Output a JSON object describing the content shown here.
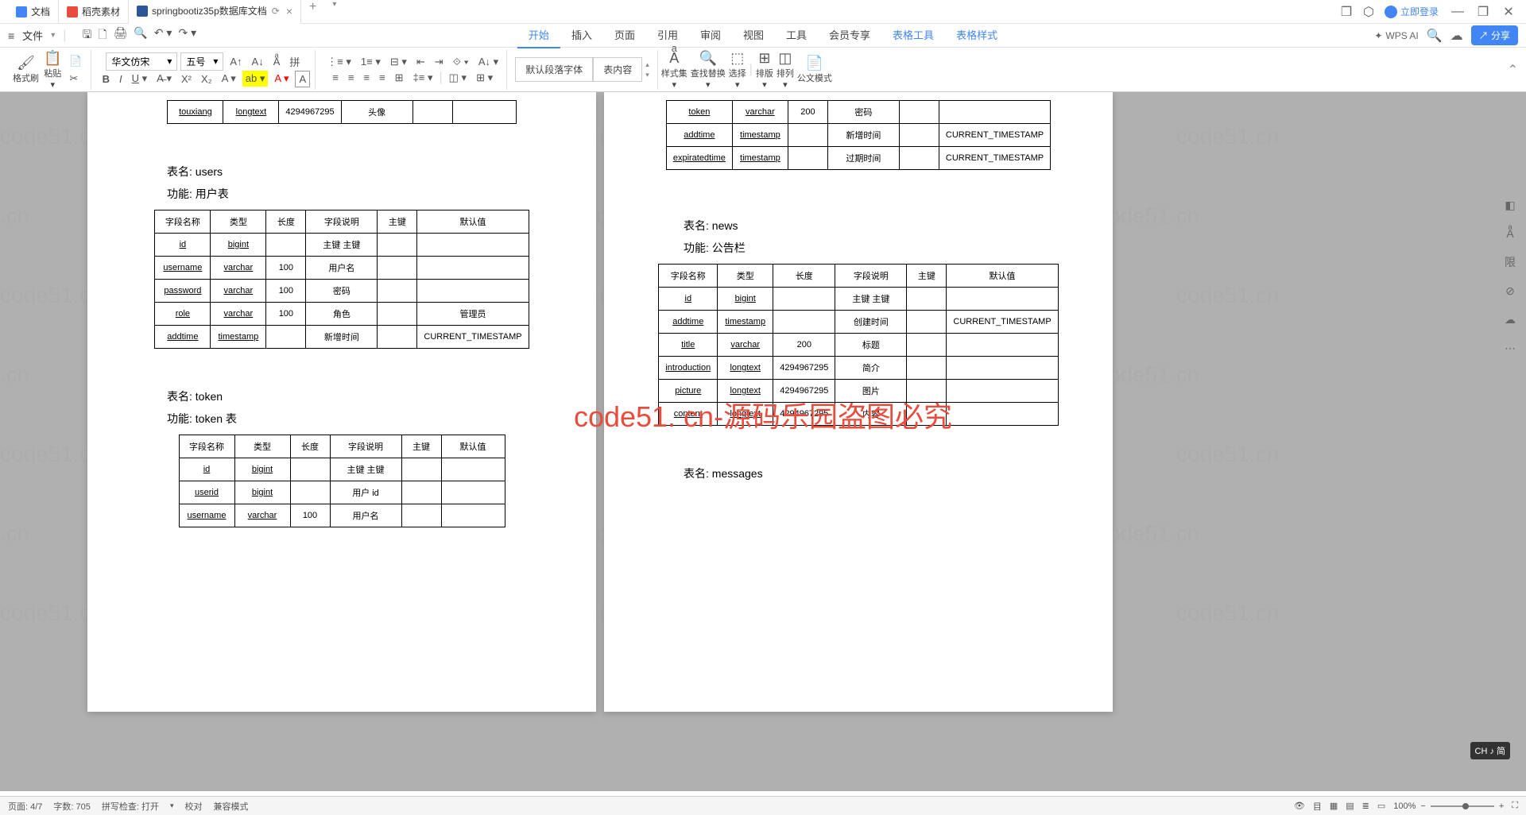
{
  "tabs": [
    {
      "label": "文档",
      "icon": "doc"
    },
    {
      "label": "稻壳素材",
      "icon": "docker"
    },
    {
      "label": "springbootiz35p数据库文档",
      "icon": "word",
      "active": true
    }
  ],
  "titlebar": {
    "login": "立即登录"
  },
  "menu": {
    "file": "文件"
  },
  "ribbon_tabs": [
    "开始",
    "插入",
    "页面",
    "引用",
    "审阅",
    "视图",
    "工具",
    "会员专享",
    "表格工具",
    "表格样式"
  ],
  "ribbon_active": "开始",
  "wps_ai": "WPS AI",
  "share": "分享",
  "ribbon": {
    "format_brush": "格式刷",
    "paste": "粘贴",
    "font": "华文仿宋",
    "size": "五号",
    "style1": "默认段落字体",
    "style2": "表内容",
    "styles_set": "样式集",
    "find_replace": "查找替换",
    "select": "选择",
    "layout": "排版",
    "arrange": "排列",
    "official": "公文模式"
  },
  "watermarks": [
    "code51.cn"
  ],
  "overlay": "code51. cn-源码乐园盗图必究",
  "left_page": {
    "table1": [
      [
        "touxiang",
        "longtext",
        "4294967295",
        "头像",
        "",
        ""
      ]
    ],
    "users_name": "表名: users",
    "users_func": "功能: 用户表",
    "users_headers": [
      "字段名称",
      "类型",
      "长度",
      "字段说明",
      "主键",
      "默认值"
    ],
    "users_rows": [
      [
        "id",
        "bigint",
        "",
        "主键\n主键",
        "",
        ""
      ],
      [
        "username",
        "varchar",
        "100",
        "用户名",
        "",
        ""
      ],
      [
        "password",
        "varchar",
        "100",
        "密码",
        "",
        ""
      ],
      [
        "role",
        "varchar",
        "100",
        "角色",
        "",
        "管理员"
      ],
      [
        "addtime",
        "timestamp",
        "",
        "新增时间",
        "",
        "CURRENT_TIMESTAMP"
      ]
    ],
    "token_name": "表名: token",
    "token_func": "功能: token 表",
    "token_headers": [
      "字段名称",
      "类型",
      "长度",
      "字段说明",
      "主键",
      "默认值"
    ],
    "token_rows": [
      [
        "id",
        "bigint",
        "",
        "主键\n主键",
        "",
        ""
      ],
      [
        "userid",
        "bigint",
        "",
        "用户 id",
        "",
        ""
      ],
      [
        "username",
        "varchar",
        "100",
        "用户名",
        "",
        ""
      ]
    ]
  },
  "right_page": {
    "table1": [
      [
        "token",
        "varchar",
        "200",
        "密码",
        "",
        ""
      ],
      [
        "addtime",
        "timestamp",
        "",
        "新增时间",
        "",
        "CURRENT_TIMESTAMP"
      ],
      [
        "expiratedtime",
        "timestamp",
        "",
        "过期时间",
        "",
        "CURRENT_TIMESTAMP"
      ]
    ],
    "news_name": "表名: news",
    "news_func": "功能: 公告栏",
    "news_headers": [
      "字段名称",
      "类型",
      "长度",
      "字段说明",
      "主键",
      "默认值"
    ],
    "news_rows": [
      [
        "id",
        "bigint",
        "",
        "主键\n主键",
        "",
        ""
      ],
      [
        "addtime",
        "timestamp",
        "",
        "创建时间",
        "",
        "CURRENT_TIMESTAMP"
      ],
      [
        "title",
        "varchar",
        "200",
        "标题",
        "",
        ""
      ],
      [
        "introduction",
        "longtext",
        "4294967295",
        "简介",
        "",
        ""
      ],
      [
        "picture",
        "longtext",
        "4294967295",
        "图片",
        "",
        ""
      ],
      [
        "content",
        "longtext",
        "4294967295",
        "内容",
        "",
        ""
      ]
    ],
    "messages_name": "表名: messages"
  },
  "statusbar": {
    "page": "页面: 4/7",
    "words": "字数: 705",
    "spell": "拼写检查: 打开",
    "proof": "校对",
    "compat": "兼容模式",
    "zoom": "100%"
  },
  "ime": "CH ♪ 简"
}
